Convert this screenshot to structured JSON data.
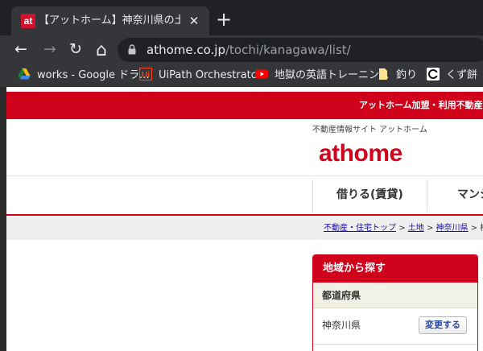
{
  "browser": {
    "tab": {
      "favicon_text": "at",
      "title": "【アットホーム】神奈川県の土地探し",
      "close": "✕"
    },
    "new_tab": "+",
    "nav": {
      "back": "←",
      "forward": "→",
      "reload": "↻",
      "home": "⌂"
    },
    "url": {
      "host": "athome.co.jp",
      "path": "/tochi/kanagawa/list/"
    },
    "bookmarks": [
      {
        "label": "works - Google ドラ...",
        "icon": "google-drive-icon"
      },
      {
        "label": "UiPath Orchestrator",
        "icon": "uipath-icon"
      },
      {
        "label": "地獄の英語トレーニン...",
        "icon": "youtube-icon"
      },
      {
        "label": "釣り",
        "icon": "folder-icon"
      },
      {
        "label": "くず餅",
        "icon": "site-icon"
      }
    ]
  },
  "page": {
    "topbar_text": "アットホーム加盟・利用不動産",
    "tagline": "不動産情報サイト アットホーム",
    "logo": "athome",
    "gnav": [
      {
        "label": "借りる(賃貸)"
      },
      {
        "label": "マンシ"
      }
    ],
    "breadcrumb": {
      "items": [
        "不動産・住宅トップ",
        "土地",
        "神奈川県"
      ],
      "separator": ">",
      "trail_tail": "> 検"
    },
    "region": {
      "header": "地域から探す",
      "pref_label": "都道府県",
      "pref_value": "神奈川県",
      "change_button": "変更する"
    }
  },
  "colors": {
    "brand": "#d0021b",
    "chrome_dark": "#202124",
    "chrome_toolbar": "#35363a"
  }
}
